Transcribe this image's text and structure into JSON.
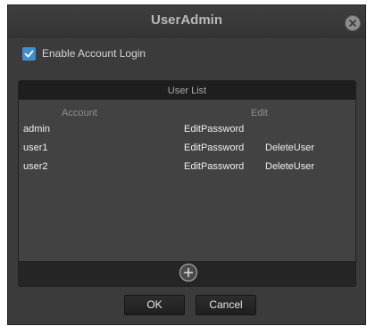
{
  "window": {
    "title": "UserAdmin",
    "close_icon": "close-icon"
  },
  "login": {
    "label": "Enable Account Login",
    "checked": true
  },
  "user_list": {
    "title": "User List",
    "columns": [
      "Account",
      "Edit"
    ],
    "rows": [
      {
        "account": "admin",
        "edit": "EditPassword",
        "delete": ""
      },
      {
        "account": "user1",
        "edit": "EditPassword",
        "delete": "DeleteUser"
      },
      {
        "account": "user2",
        "edit": "EditPassword",
        "delete": "DeleteUser"
      }
    ],
    "add_icon": "plus-circle-icon"
  },
  "buttons": {
    "ok": "OK",
    "cancel": "Cancel"
  },
  "colors": {
    "accent": "#3e8ed0",
    "background": "#3b3b3b",
    "panel_header": "#1e1e1e"
  }
}
